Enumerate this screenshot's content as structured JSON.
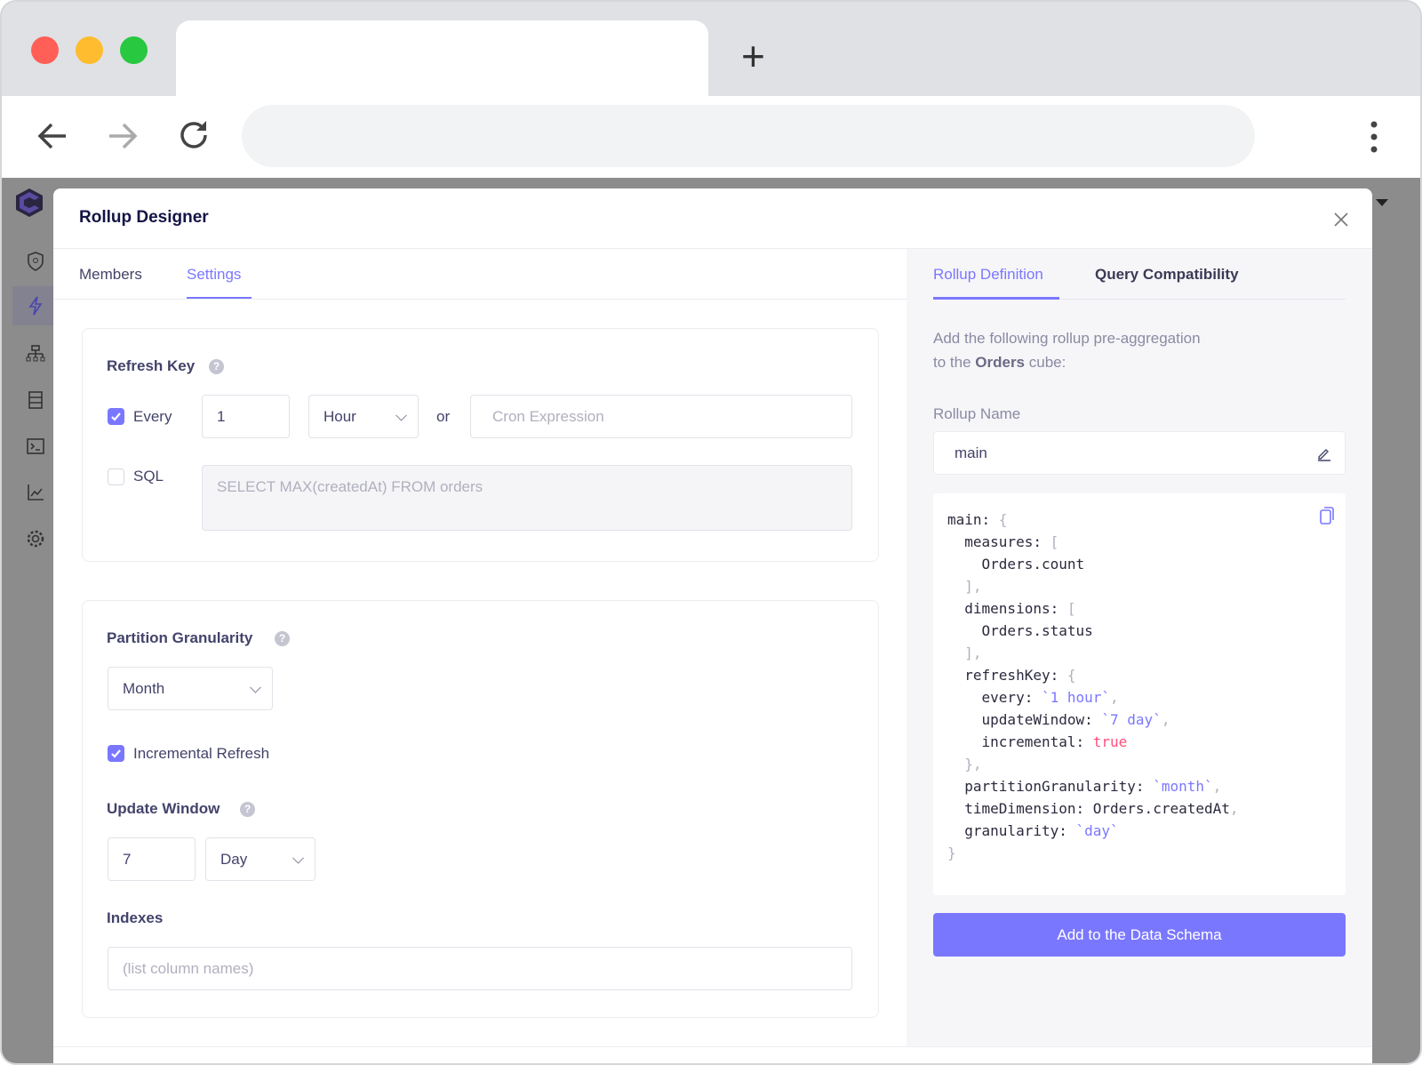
{
  "browser": {
    "new_tab": "+",
    "colors": {
      "close": "#ff5f57",
      "minimize": "#febc2e",
      "maximize": "#28c840"
    }
  },
  "modal": {
    "title": "Rollup Designer",
    "left_tabs": [
      {
        "label": "Members",
        "active": false
      },
      {
        "label": "Settings",
        "active": true
      }
    ],
    "refresh_key": {
      "title": "Refresh Key",
      "every_checked": true,
      "every_label": "Every",
      "every_value": "1",
      "every_unit": "Hour",
      "or_label": "or",
      "cron_placeholder": "Cron Expression",
      "sql_checked": false,
      "sql_label": "SQL",
      "sql_placeholder": "SELECT MAX(createdAt) FROM orders"
    },
    "partition": {
      "title": "Partition Granularity",
      "granularity": "Month",
      "incremental_checked": true,
      "incremental_label": "Incremental Refresh",
      "update_window_title": "Update Window",
      "update_window_value": "7",
      "update_window_unit": "Day",
      "indexes_title": "Indexes",
      "indexes_placeholder": "(list column names)"
    },
    "right_tabs": [
      {
        "label": "Rollup Definition",
        "active": true
      },
      {
        "label": "Query Compatibility",
        "active": false
      }
    ],
    "description_1": "Add the following rollup pre-aggregation",
    "description_2a": "to the ",
    "description_cube": "Orders",
    "description_2b": " cube:",
    "rollup_name_label": "Rollup Name",
    "rollup_name": "main",
    "code": {
      "l1": "main: ",
      "l1b": "{",
      "l2": "  measures: ",
      "l2b": "[",
      "l3": "    Orders.count",
      "l4": "  ],",
      "l5": "  dimensions: ",
      "l5b": "[",
      "l6": "    Orders.status",
      "l7": "  ],",
      "l8": "  refreshKey: ",
      "l8b": "{",
      "l9": "    every: ",
      "l9s": "`1 hour`",
      "l9c": ",",
      "l10": "    updateWindow: ",
      "l10s": "`7 day`",
      "l10c": ",",
      "l11": "    incremental: ",
      "l11s": "true",
      "l12": "  },",
      "l13": "  partitionGranularity: ",
      "l13s": "`month`",
      "l13c": ",",
      "l14": "  timeDimension: Orders.createdAt",
      "l14c": ",",
      "l15": "  granularity: ",
      "l15s": "`day`",
      "l16": "}"
    },
    "add_button": "Add to the Data Schema",
    "accent": "#7a77ff"
  }
}
